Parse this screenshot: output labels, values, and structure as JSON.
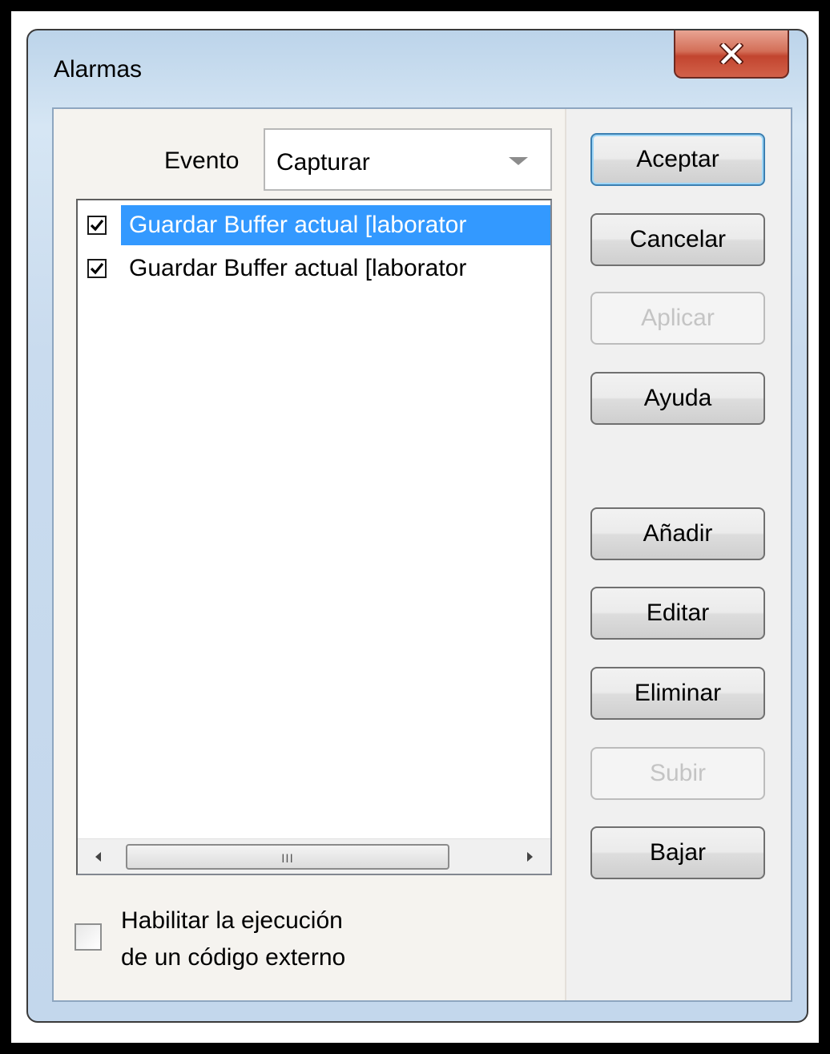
{
  "window": {
    "title": "Alarmas",
    "close_icon": "close-icon"
  },
  "evento": {
    "label": "Evento",
    "selected": "Capturar"
  },
  "list": {
    "items": [
      {
        "label": "Guardar Buffer actual [laborator",
        "checked": true,
        "selected": true
      },
      {
        "label": "Guardar Buffer actual [laborator",
        "checked": true,
        "selected": false
      }
    ],
    "scroll_grip": "III"
  },
  "exec_option": {
    "line1": "Habilitar la ejecución",
    "line2": "de un código externo",
    "checked": false
  },
  "buttons": {
    "accept": "Aceptar",
    "cancel": "Cancelar",
    "apply": "Aplicar",
    "help": "Ayuda",
    "add": "Añadir",
    "edit": "Editar",
    "delete": "Eliminar",
    "up": "Subir",
    "down": "Bajar"
  },
  "colors": {
    "selection": "#3399ff",
    "close_button": "#c2452f"
  }
}
